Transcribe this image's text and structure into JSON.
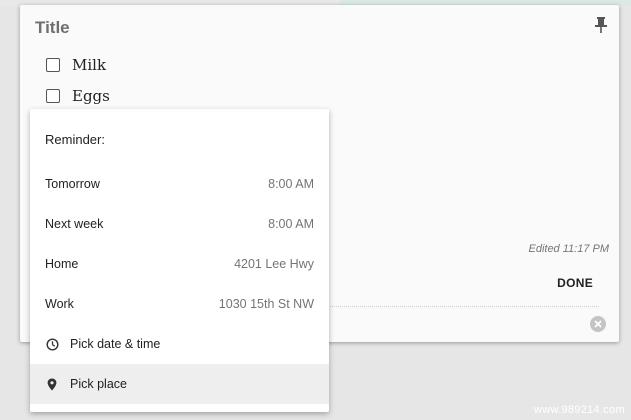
{
  "note": {
    "title": "Title",
    "items": [
      {
        "label": "Milk",
        "checked": false
      },
      {
        "label": "Eggs",
        "checked": false
      }
    ],
    "edited": "Edited 11:17 PM",
    "done_label": "DONE"
  },
  "reminder_menu": {
    "header": "Reminder:",
    "options": [
      {
        "label": "Tomorrow",
        "value": "8:00 AM"
      },
      {
        "label": "Next week",
        "value": "8:00 AM"
      },
      {
        "label": "Home",
        "value": "4201 Lee Hwy"
      },
      {
        "label": "Work",
        "value": "1030 15th St NW"
      }
    ],
    "pick_date_label": "Pick date & time",
    "pick_place_label": "Pick place"
  },
  "icons": {
    "pin": "pin-icon",
    "clock": "clock-icon",
    "place": "location-pin-icon",
    "close": "close-circle-icon"
  },
  "watermark": "www.989214.com"
}
